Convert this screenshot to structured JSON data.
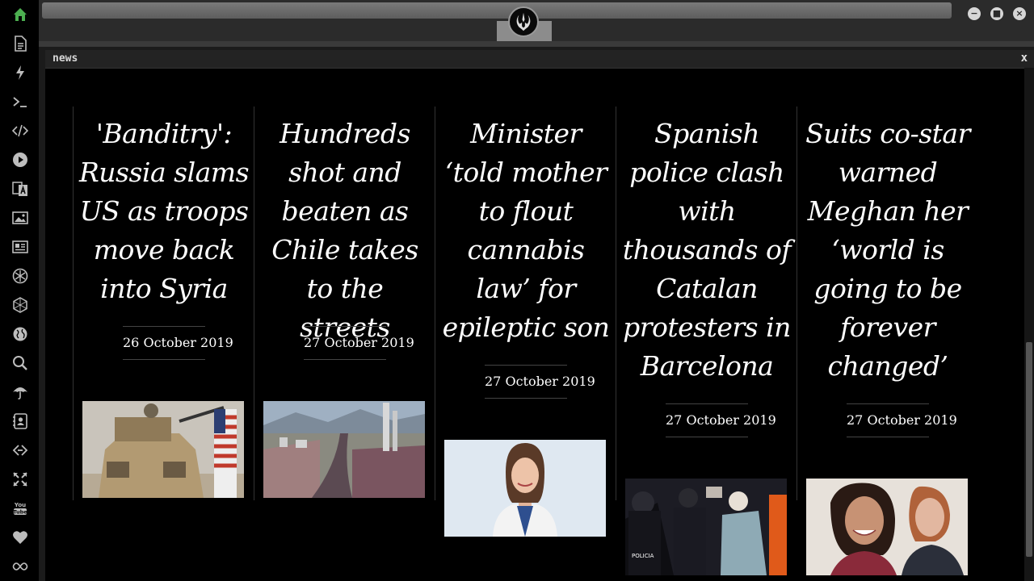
{
  "sidebar": {
    "items": [
      {
        "name": "home-icon",
        "glyph": "⌂",
        "active": true
      },
      {
        "name": "document-icon",
        "glyph": "🗎"
      },
      {
        "name": "lightning-icon",
        "glyph": "ϟ"
      },
      {
        "name": "terminal-icon",
        "glyph": ">_"
      },
      {
        "name": "code-icon",
        "glyph": "</>"
      },
      {
        "name": "play-icon",
        "glyph": "▶"
      },
      {
        "name": "translate-icon",
        "glyph": "文"
      },
      {
        "name": "image-icon",
        "glyph": "▣"
      },
      {
        "name": "newspaper-icon",
        "glyph": "▤"
      },
      {
        "name": "rebel-icon",
        "glyph": "✲"
      },
      {
        "name": "hexagon-icon",
        "glyph": "⬡"
      },
      {
        "name": "globe-icon",
        "glyph": "◍"
      },
      {
        "name": "search-icon",
        "glyph": "⌕"
      },
      {
        "name": "umbrella-icon",
        "glyph": "☂"
      },
      {
        "name": "contact-icon",
        "glyph": "☷"
      },
      {
        "name": "link-icon",
        "glyph": "⟐"
      },
      {
        "name": "expand-icon",
        "glyph": "✣"
      },
      {
        "name": "youtube-icon",
        "glyph": "▶"
      },
      {
        "name": "heart-icon",
        "glyph": "♥"
      },
      {
        "name": "infinity-icon",
        "glyph": "∞"
      }
    ]
  },
  "window": {
    "minimize_label": "−",
    "maximize_label": "■",
    "close_label": "×",
    "logo_icon": "rebel-alliance-icon"
  },
  "panel": {
    "title": "news",
    "close_label": "x"
  },
  "articles": [
    {
      "headline": "'Banditry': Russia slams US as troops move back into Syria",
      "date": "26 October 2019",
      "image": "armored-vehicle-with-soldiers-and-us-flag"
    },
    {
      "headline": "Hundreds shot and beaten as Chile takes to the streets",
      "date": "27 October 2019",
      "image": "aerial-view-of-crowd-in-santiago"
    },
    {
      "headline": "Minister ‘told mother to flout cannabis law’ for epileptic son",
      "date": "27 October 2019",
      "image": "portrait-of-smiling-woman"
    },
    {
      "headline": "Spanish police clash with thousands of Catalan protesters in Barcelona",
      "date": "27 October 2019",
      "image": "police-clashing-with-protesters"
    },
    {
      "headline": "Suits co-star warned Meghan her ‘world is going to be forever changed’",
      "date": "27 October 2019",
      "image": "meghan-and-harry-smiling"
    }
  ],
  "colors": {
    "accent_active": "#4caf50",
    "panel_bg": "#000000",
    "text": "#ffffff"
  }
}
